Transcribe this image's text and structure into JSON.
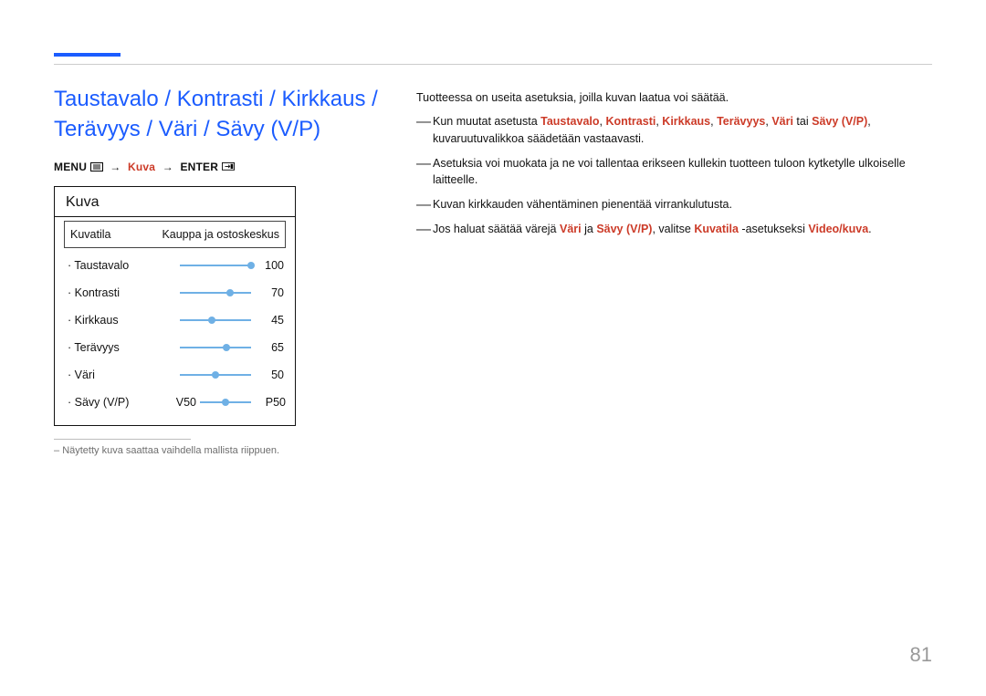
{
  "page_number": "81",
  "title": "Taustavalo / Kontrasti / Kirkkaus / Terävyys / Väri / Sävy (V/P)",
  "breadcrumb": {
    "menu_label": "MENU",
    "kuva": "Kuva",
    "enter_label": "ENTER"
  },
  "panel": {
    "header": "Kuva",
    "mode_label": "Kuvatila",
    "mode_value": "Kauppa ja ostoskeskus",
    "rows": [
      {
        "label": "Taustavalo",
        "value": "100",
        "pct": 100
      },
      {
        "label": "Kontrasti",
        "value": "70",
        "pct": 70
      },
      {
        "label": "Kirkkaus",
        "value": "45",
        "pct": 45
      },
      {
        "label": "Terävyys",
        "value": "65",
        "pct": 65
      },
      {
        "label": "Väri",
        "value": "50",
        "pct": 50
      }
    ],
    "tint": {
      "label": "Sävy (V/P)",
      "left": "V50",
      "right": "P50",
      "pct": 50
    }
  },
  "footnote": "Näytetty kuva saattaa vaihdella mallista riippuen.",
  "right": {
    "intro": "Tuotteessa on useita asetuksia, joilla kuvan laatua voi säätää.",
    "note1_pre": "Kun muutat asetusta ",
    "t1": "Taustavalo",
    "c": ", ",
    "t2": "Kontrasti",
    "t3": "Kirkkaus",
    "t4": "Terävyys",
    "t5": "Väri",
    "tai": " tai ",
    "t6": "Sävy (V/P)",
    "note1_post": ", kuvaruutuvalikkoa säädetään vastaavasti.",
    "note2": "Asetuksia voi muokata ja ne voi tallentaa erikseen kullekin tuotteen tuloon kytketylle ulkoiselle laitteelle.",
    "note3": "Kuvan kirkkauden vähentäminen pienentää virrankulutusta.",
    "note4_pre": "Jos haluat säätää värejä ",
    "n4a": "Väri",
    "ja": " ja ",
    "n4b": "Sävy (V/P)",
    "note4_mid": ", valitse ",
    "n4c": "Kuvatila",
    "note4_mid2": " -asetukseksi ",
    "n4d": "Video/kuva",
    "dot": "."
  }
}
